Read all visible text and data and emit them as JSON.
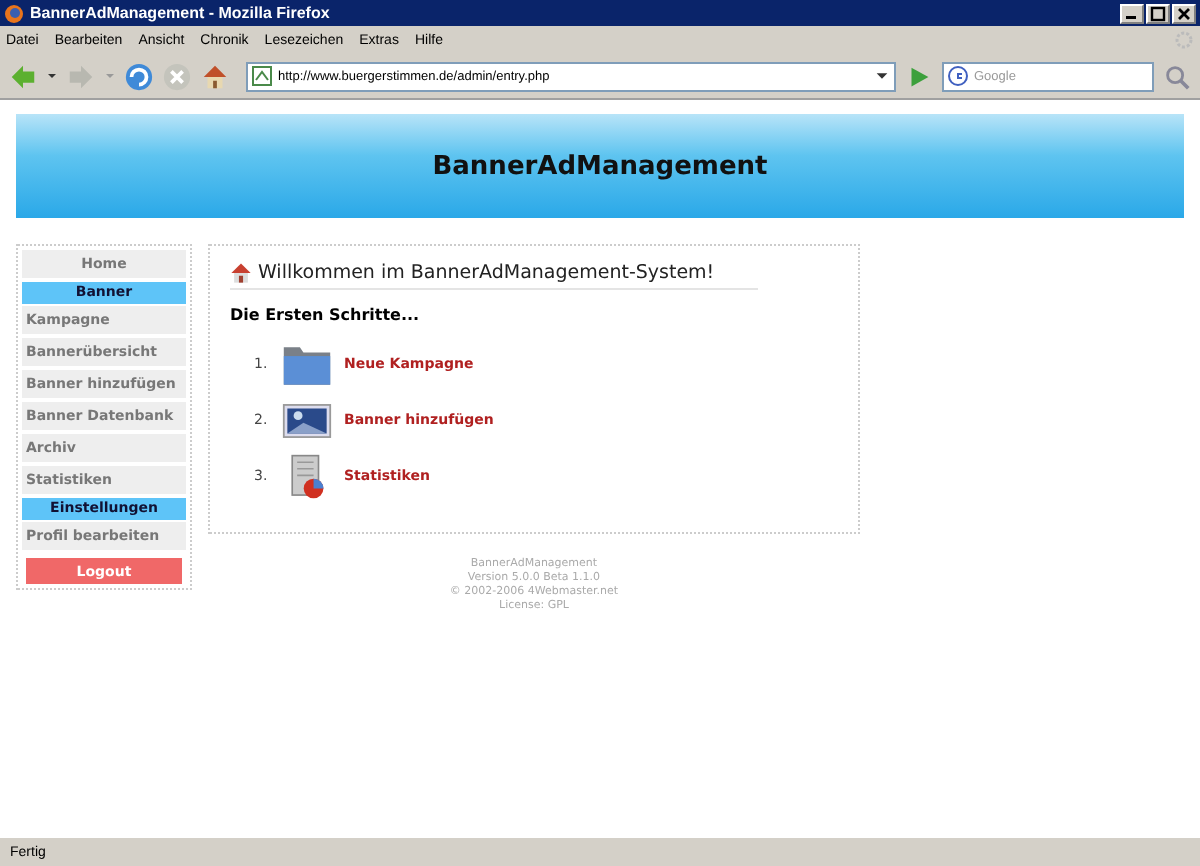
{
  "window": {
    "title": "BannerAdManagement - Mozilla Firefox"
  },
  "menu": [
    "Datei",
    "Bearbeiten",
    "Ansicht",
    "Chronik",
    "Lesezeichen",
    "Extras",
    "Hilfe"
  ],
  "address": {
    "value": "http://www.buergerstimmen.de/admin/entry.php"
  },
  "search": {
    "placeholder": "Google"
  },
  "header": {
    "title": "BannerAdManagement"
  },
  "sidebar": [
    {
      "kind": "home",
      "label": "Home"
    },
    {
      "kind": "section",
      "label": "Banner"
    },
    {
      "kind": "link",
      "label": "Kampagne"
    },
    {
      "kind": "link",
      "label": "Bannerübersicht"
    },
    {
      "kind": "link",
      "label": "Banner hinzufügen"
    },
    {
      "kind": "link",
      "label": "Banner Datenbank"
    },
    {
      "kind": "link",
      "label": "Archiv"
    },
    {
      "kind": "link",
      "label": "Statistiken"
    },
    {
      "kind": "section",
      "label": "Einstellungen"
    },
    {
      "kind": "link",
      "label": "Profil bearbeiten"
    },
    {
      "kind": "logout",
      "label": "Logout"
    }
  ],
  "main": {
    "title": "Willkommen im BannerAdManagement-System!",
    "subtitle": "Die Ersten Schritte...",
    "steps": [
      {
        "number": "1.",
        "kind": "folder",
        "label": "Neue Kampagne"
      },
      {
        "number": "2.",
        "kind": "image",
        "label": "Banner hinzufügen"
      },
      {
        "number": "3.",
        "kind": "stats",
        "label": "Statistiken"
      }
    ]
  },
  "footer": [
    "BannerAdManagement",
    "Version 5.0.0 Beta 1.1.0",
    "© 2002-2006 4Webmaster.net",
    "License: GPL"
  ],
  "status_bar": {
    "text": "Fertig"
  }
}
